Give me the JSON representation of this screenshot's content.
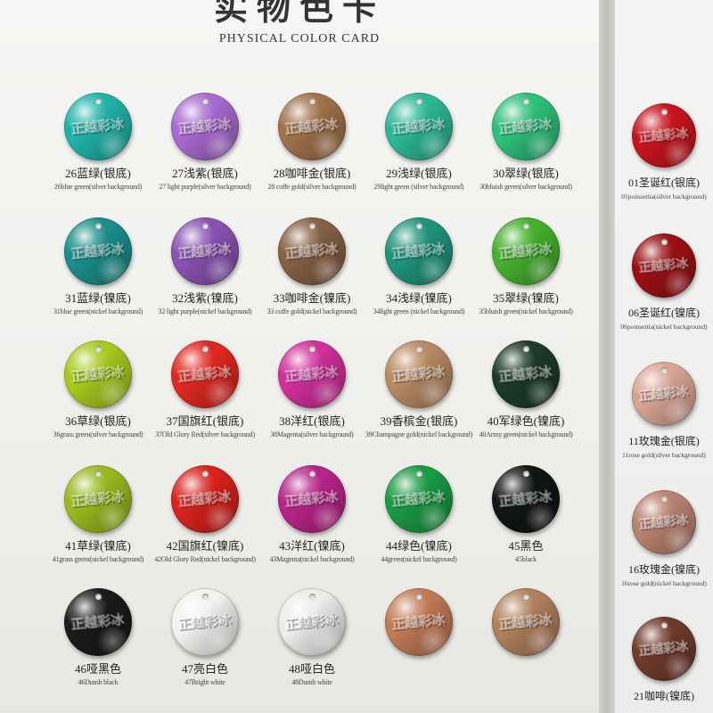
{
  "title_cn": "实物色卡",
  "title_en": "PHYSICAL COLOR CARD",
  "emboss_text": "正越彩冰",
  "main_rows": [
    [
      {
        "cn": "26蓝绿(银底)",
        "en": "26blue green(silver background)",
        "color": "#1fb3a8"
      },
      {
        "cn": "27浅紫(银底)",
        "en": "27 light purple(silver background)",
        "color": "#a86ad0"
      },
      {
        "cn": "28咖啡金(银底)",
        "en": "28 coffe gold(silver background)",
        "color": "#a0724a"
      },
      {
        "cn": "29浅绿(银底)",
        "en": "29light green (silver background)",
        "color": "#2cb896"
      },
      {
        "cn": "30翠绿(银底)",
        "en": "30bluish green(silver background)",
        "color": "#2cc07a"
      }
    ],
    [
      {
        "cn": "31蓝绿(镍底)",
        "en": "31blue green(nickel background)",
        "color": "#1a8e8a"
      },
      {
        "cn": "32浅紫(镍底)",
        "en": "32 light purple(nickel background)",
        "color": "#8a52b0"
      },
      {
        "cn": "33咖啡金(镍底)",
        "en": "33 coffe gold(nickel background)",
        "color": "#856043"
      },
      {
        "cn": "34浅绿(镍底)",
        "en": "34light green (nickel background)",
        "color": "#1e947c"
      },
      {
        "cn": "35翠绿(镍底)",
        "en": "35bluish green(nickel background)",
        "color": "#44b02c"
      }
    ],
    [
      {
        "cn": "36草绿(银底)",
        "en": "36grass green(silver background)",
        "color": "#a8c81e"
      },
      {
        "cn": "37国旗红(银底)",
        "en": "37Old Glory Red(silver background)",
        "color": "#e02820"
      },
      {
        "cn": "38洋红(银底)",
        "en": "38Magenta(silver background)",
        "color": "#d0309a"
      },
      {
        "cn": "39香槟金(银底)",
        "en": "39Champagne gold(nickel background)",
        "color": "#b88a62"
      },
      {
        "cn": "40军绿色(镍底)",
        "en": "40Army green(nickel background)",
        "color": "#1c3a2a"
      }
    ],
    [
      {
        "cn": "41草绿(镍底)",
        "en": "41grass green(nickel background)",
        "color": "#9ab81e"
      },
      {
        "cn": "42国旗红(镍底)",
        "en": "42Old Glory Red(nickel background)",
        "color": "#d8221c"
      },
      {
        "cn": "43洋红(镍底)",
        "en": "43Magenta(nickel background)",
        "color": "#b82488"
      },
      {
        "cn": "44绿色(镍底)",
        "en": "44green(nickel background)",
        "color": "#1a9a44"
      },
      {
        "cn": "45黑色",
        "en": "45black",
        "color": "#111513"
      }
    ],
    [
      {
        "cn": "46哑黑色",
        "en": "46Dumb black",
        "color": "#1a1a1a"
      },
      {
        "cn": "47亮白色",
        "en": "47Bright white",
        "color": "#f2f2f0"
      },
      {
        "cn": "48哑白色",
        "en": "48Dumb white",
        "color": "#ececea"
      },
      {
        "cn": "",
        "en": "",
        "color": "#c07a56"
      },
      {
        "cn": "",
        "en": "",
        "color": "#b0805c"
      }
    ]
  ],
  "side_items": [
    {
      "cn": "01圣诞红(银底)",
      "en": "01poinsettia(silver background)",
      "color": "#c8141e"
    },
    {
      "cn": "06圣诞红(镍底)",
      "en": "06poinsettia(nickel background)",
      "color": "#9a1014"
    },
    {
      "cn": "11玫瑰金(银底)",
      "en": "11rose gold(silver background)",
      "color": "#d8a494"
    },
    {
      "cn": "16玫瑰金(镍底)",
      "en": "16rose gold(nickel background)",
      "color": "#b88270"
    },
    {
      "cn": "21咖啡(镍底)",
      "en": "",
      "color": "#6e3a2c"
    }
  ]
}
